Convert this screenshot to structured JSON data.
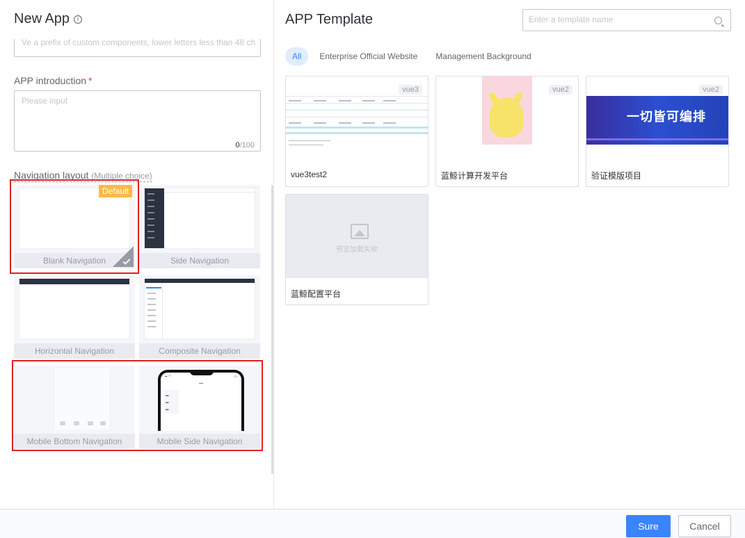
{
  "left": {
    "title": "New App",
    "info_glyph": "i",
    "prefix_hint": "Ve a prefix of custom components, lower letters less than 48 ch",
    "intro_label": "APP introduction",
    "required_mark": "*",
    "intro_placeholder": "Please input",
    "intro_count_current": "0",
    "intro_count_max": "/100",
    "nav_label": "Navigation layout",
    "nav_label_sub": "(Multiple choice)",
    "default_badge": "Default",
    "nav_options": [
      {
        "label": "Blank Navigation"
      },
      {
        "label": "Side Navigation"
      },
      {
        "label": "Horizontal Navigation"
      },
      {
        "label": "Composite Navigation"
      },
      {
        "label": "Mobile Bottom Navigation"
      },
      {
        "label": "Mobile Side Navigation"
      }
    ]
  },
  "right": {
    "title": "APP Template",
    "search_placeholder": "Enter a template name",
    "tabs": [
      {
        "label": "All",
        "active": true
      },
      {
        "label": "Enterprise Official Website"
      },
      {
        "label": "Management Background"
      }
    ],
    "templates": [
      {
        "name": "vue3test2",
        "version": "vue3"
      },
      {
        "name": "蓝鲸计算开发平台",
        "version": "vue2"
      },
      {
        "name": "验证模版项目",
        "version": "vue2",
        "banner_text": "一切皆可编排"
      },
      {
        "name": "蓝鲸配置平台",
        "image_fallback": "预览加载失败"
      }
    ]
  },
  "footer": {
    "sure": "Sure",
    "cancel": "Cancel"
  },
  "colors": {
    "primary": "#3a84ff",
    "selection_border": "#e02020",
    "default_badge": "#ffb848"
  }
}
